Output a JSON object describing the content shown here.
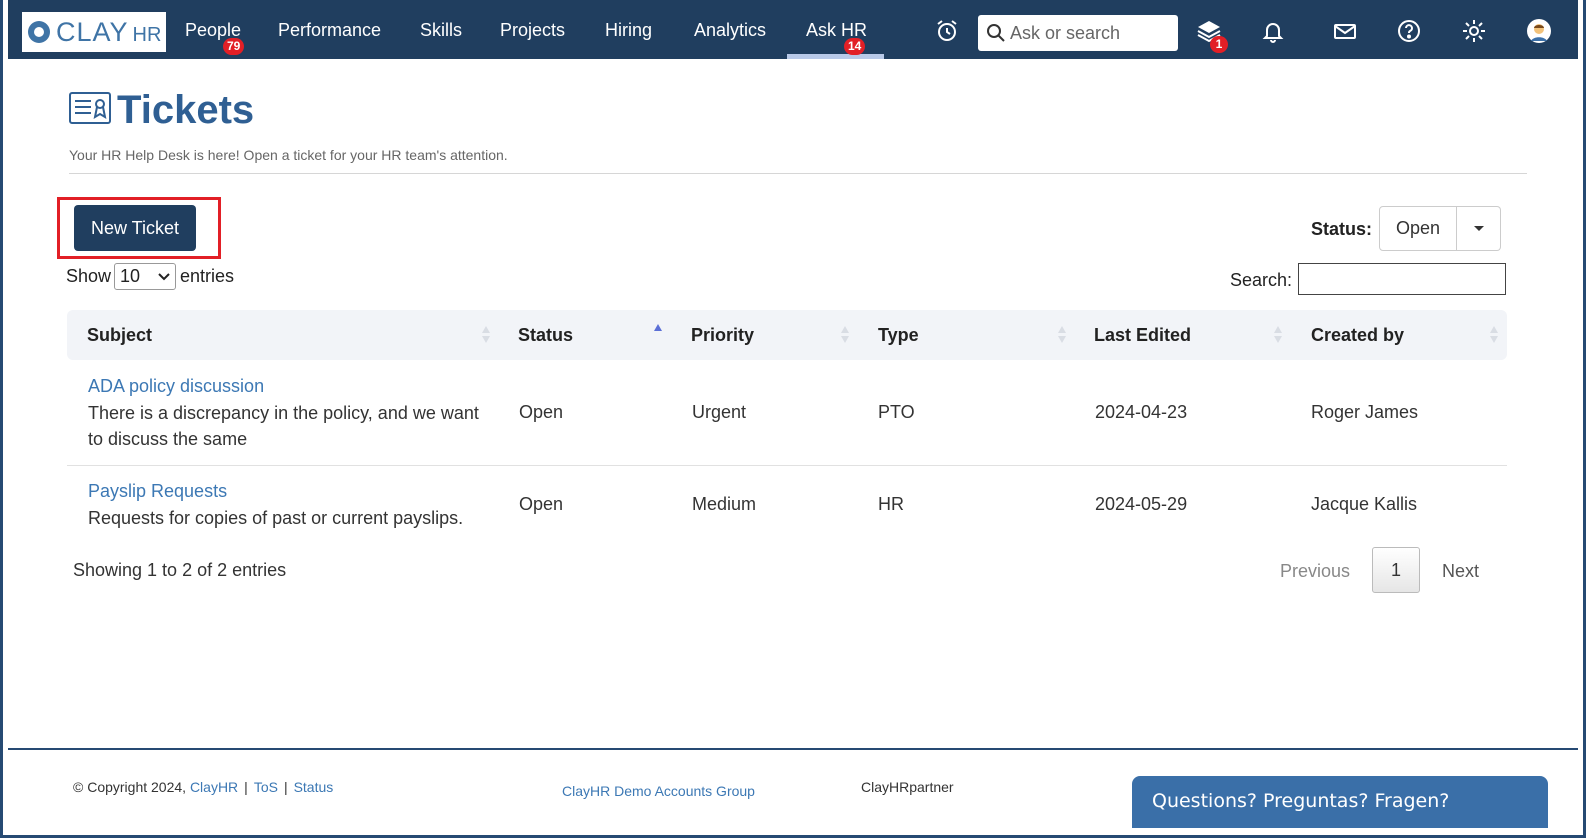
{
  "logo": {
    "clay": "CLAY",
    "hr": "HR"
  },
  "nav": {
    "items": [
      {
        "label": "People",
        "badge": "79"
      },
      {
        "label": "Performance"
      },
      {
        "label": "Skills"
      },
      {
        "label": "Projects"
      },
      {
        "label": "Hiring"
      },
      {
        "label": "Analytics"
      },
      {
        "label": "Ask HR",
        "badge": "14"
      }
    ],
    "search_placeholder": "Ask or search",
    "stack_badge": "1"
  },
  "page": {
    "title": "Tickets",
    "subtitle": "Your HR Help Desk is here! Open a ticket for your HR team's attention."
  },
  "controls": {
    "new_ticket": "New Ticket",
    "show": "Show",
    "entries_value": "10",
    "entries": "entries",
    "status_label": "Status:",
    "status_value": "Open",
    "search_label": "Search:"
  },
  "table": {
    "headers": [
      "Subject",
      "Status",
      "Priority",
      "Type",
      "Last Edited",
      "Created by"
    ],
    "rows": [
      {
        "subject": "ADA policy discussion",
        "description": "There is a discrepancy in the policy, and we want to discuss the same",
        "status": "Open",
        "priority": "Urgent",
        "type": "PTO",
        "last_edited": "2024-04-23",
        "created_by": "Roger James"
      },
      {
        "subject": "Payslip Requests",
        "description": "Requests for copies of past or current payslips.",
        "status": "Open",
        "priority": "Medium",
        "type": "HR",
        "last_edited": "2024-05-29",
        "created_by": "Jacque Kallis"
      }
    ]
  },
  "pagination": {
    "showing": "Showing 1 to 2 of 2 entries",
    "previous": "Previous",
    "page": "1",
    "next": "Next"
  },
  "footer": {
    "copyright": "© Copyright 2024,",
    "clayhr": "ClayHR",
    "tos": "ToS",
    "status": "Status",
    "group": "ClayHR Demo Accounts Group",
    "partner": "ClayHRpartner",
    "chat": "Questions? Preguntas? Fragen?"
  },
  "colors": {
    "nav_bg": "#203e5f",
    "accent": "#2f5f93",
    "link": "#3c78b4",
    "badge": "#e21f26",
    "highlight": "#e21f26"
  }
}
